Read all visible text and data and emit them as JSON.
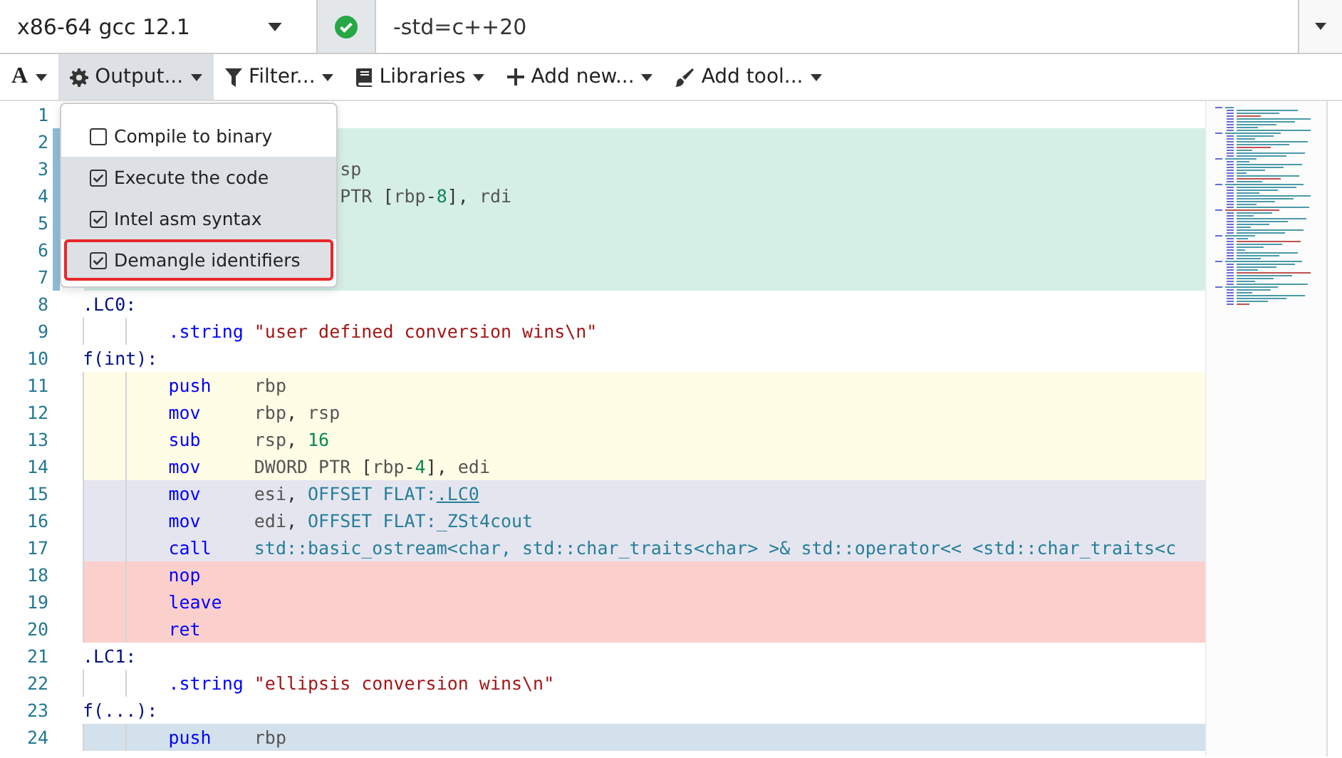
{
  "compiler": {
    "name": "x86-64 gcc 12.1",
    "compiled": true,
    "options": "-std=c++20"
  },
  "toolbar": [
    {
      "kind": "font",
      "label": "A",
      "active": false
    },
    {
      "kind": "gear",
      "label": "Output...",
      "active": true
    },
    {
      "kind": "filter",
      "label": "Filter...",
      "active": false
    },
    {
      "kind": "book",
      "label": "Libraries",
      "active": false
    },
    {
      "kind": "plus",
      "label": "Add new...",
      "active": false
    },
    {
      "kind": "tool",
      "label": "Add tool...",
      "active": false
    }
  ],
  "output_menu": [
    {
      "label": "Compile to binary",
      "checked": false,
      "annotated": false
    },
    {
      "label": "Execute the code",
      "checked": true,
      "annotated": false
    },
    {
      "label": "Intel asm syntax",
      "checked": true,
      "annotated": false
    },
    {
      "label": "Demangle identifiers",
      "checked": true,
      "annotated": true
    }
  ],
  "lines": [
    {
      "n": "1",
      "marker": false,
      "color": "#ffffff",
      "kind": "covered"
    },
    {
      "n": "2",
      "marker": true,
      "color": "#d6efe6",
      "kind": "covered"
    },
    {
      "n": "3",
      "marker": true,
      "color": "#d6efe6",
      "kind": "covered",
      "tokens": [
        {
          "kind": "reg",
          "text": "sp"
        }
      ]
    },
    {
      "n": "4",
      "marker": true,
      "color": "#d6efe6",
      "kind": "covered",
      "tokens": [
        {
          "kind": "reg",
          "text": "PTR "
        },
        {
          "kind": "punct",
          "text": "["
        },
        {
          "kind": "reg",
          "text": "rbp"
        },
        {
          "kind": "punct",
          "text": "-"
        },
        {
          "kind": "num",
          "text": "8"
        },
        {
          "kind": "punct",
          "text": "], "
        },
        {
          "kind": "reg",
          "text": "rdi"
        }
      ]
    },
    {
      "n": "5",
      "marker": true,
      "color": "#d6efe6",
      "kind": "covered"
    },
    {
      "n": "6",
      "marker": true,
      "color": "#d6efe6",
      "kind": "covered"
    },
    {
      "n": "7",
      "marker": true,
      "color": "#d6efe6",
      "kind": "covered"
    },
    {
      "n": "8",
      "marker": false,
      "color": "#ffffff",
      "kind": "label",
      "tokens": [
        {
          "kind": "label",
          "text": ".LC0:"
        }
      ]
    },
    {
      "n": "9",
      "marker": false,
      "color": "#ffffff",
      "kind": "instr",
      "op": ".string",
      "tokens": [
        {
          "kind": "str",
          "text": "\"user defined conversion wins\\n\""
        }
      ]
    },
    {
      "n": "10",
      "marker": false,
      "color": "#ffffff",
      "kind": "label",
      "tokens": [
        {
          "kind": "label",
          "text": "f(int):"
        }
      ]
    },
    {
      "n": "11",
      "marker": false,
      "color": "#fffde6",
      "kind": "instr",
      "op": "push",
      "tokens": [
        {
          "kind": "reg",
          "text": "rbp"
        }
      ]
    },
    {
      "n": "12",
      "marker": false,
      "color": "#fffde6",
      "kind": "instr",
      "op": "mov",
      "tokens": [
        {
          "kind": "reg",
          "text": "rbp"
        },
        {
          "kind": "punct",
          "text": ", "
        },
        {
          "kind": "reg",
          "text": "rsp"
        }
      ]
    },
    {
      "n": "13",
      "marker": false,
      "color": "#fffde6",
      "kind": "instr",
      "op": "sub",
      "tokens": [
        {
          "kind": "reg",
          "text": "rsp"
        },
        {
          "kind": "punct",
          "text": ", "
        },
        {
          "kind": "num",
          "text": "16"
        }
      ]
    },
    {
      "n": "14",
      "marker": false,
      "color": "#fffde6",
      "kind": "instr",
      "op": "mov",
      "tokens": [
        {
          "kind": "reg",
          "text": "DWORD PTR "
        },
        {
          "kind": "punct",
          "text": "["
        },
        {
          "kind": "reg",
          "text": "rbp"
        },
        {
          "kind": "punct",
          "text": "-"
        },
        {
          "kind": "num",
          "text": "4"
        },
        {
          "kind": "punct",
          "text": "], "
        },
        {
          "kind": "reg",
          "text": "edi"
        }
      ]
    },
    {
      "n": "15",
      "marker": false,
      "color": "#e5e5f0",
      "kind": "instr",
      "op": "mov",
      "tokens": [
        {
          "kind": "reg",
          "text": "esi"
        },
        {
          "kind": "punct",
          "text": ", "
        },
        {
          "kind": "sym",
          "text": "OFFSET FLAT:"
        },
        {
          "kind": "link",
          "text": ".LC0"
        }
      ]
    },
    {
      "n": "16",
      "marker": false,
      "color": "#e5e5f0",
      "kind": "instr",
      "op": "mov",
      "tokens": [
        {
          "kind": "reg",
          "text": "edi"
        },
        {
          "kind": "punct",
          "text": ", "
        },
        {
          "kind": "sym",
          "text": "OFFSET FLAT:_ZSt4cout"
        }
      ]
    },
    {
      "n": "17",
      "marker": false,
      "color": "#e5e5f0",
      "kind": "instr",
      "op": "call",
      "tokens": [
        {
          "kind": "sym",
          "text": "std::basic_ostream<char, std::char_traits<char> >& std::operator<< <std::char_traits<c"
        }
      ]
    },
    {
      "n": "18",
      "marker": false,
      "color": "#fbd0cc",
      "kind": "instr",
      "op": "nop"
    },
    {
      "n": "19",
      "marker": false,
      "color": "#fbd0cc",
      "kind": "instr",
      "op": "leave"
    },
    {
      "n": "20",
      "marker": false,
      "color": "#fbd0cc",
      "kind": "instr",
      "op": "ret"
    },
    {
      "n": "21",
      "marker": false,
      "color": "#ffffff",
      "kind": "label",
      "tokens": [
        {
          "kind": "label",
          "text": ".LC1:"
        }
      ]
    },
    {
      "n": "22",
      "marker": false,
      "color": "#ffffff",
      "kind": "instr",
      "op": ".string",
      "tokens": [
        {
          "kind": "str",
          "text": "\"ellipsis conversion wins\\n\""
        }
      ]
    },
    {
      "n": "23",
      "marker": false,
      "color": "#ffffff",
      "kind": "label",
      "tokens": [
        {
          "kind": "label",
          "text": "f(...):"
        }
      ]
    },
    {
      "n": "24",
      "marker": false,
      "color": "#d3e1ec",
      "kind": "instr",
      "op": "push",
      "tokens": [
        {
          "kind": "reg",
          "text": "rbp"
        }
      ]
    }
  ]
}
